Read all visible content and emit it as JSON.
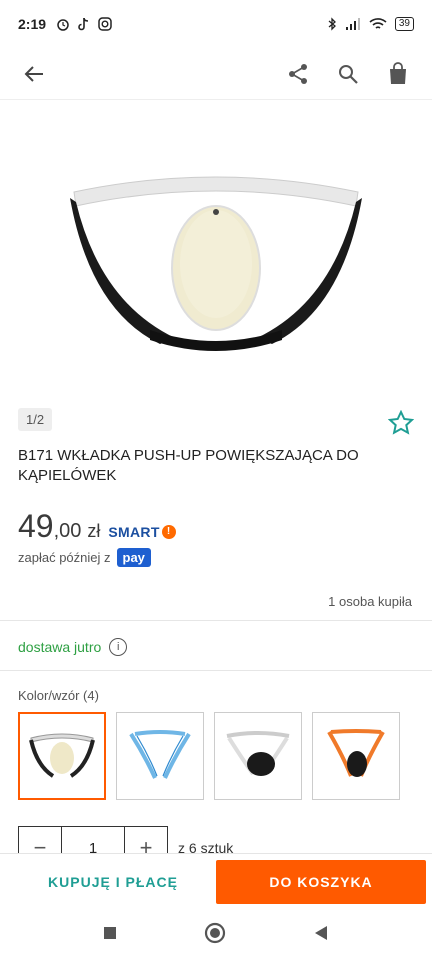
{
  "status": {
    "time": "2:19",
    "battery": "39"
  },
  "gallery": {
    "counter": "1/2"
  },
  "product": {
    "title": "B171 WKŁADKA PUSH-UP POWIĘKSZAJĄCA DO KĄPIELÓWEK",
    "price_main": "49",
    "price_decimal": ",00",
    "currency": "zł",
    "smart": "SMART",
    "pay_later": "zapłać później z",
    "pay_logo": "pay",
    "buyers": "1 osoba kupiła",
    "delivery": "dostawa jutro"
  },
  "variants": {
    "label": "Kolor/wzór (4)",
    "items": [
      {
        "name": "white-beige",
        "selected": true
      },
      {
        "name": "blue",
        "selected": false
      },
      {
        "name": "black-white",
        "selected": false
      },
      {
        "name": "orange-black",
        "selected": false
      }
    ]
  },
  "quantity": {
    "value": "1",
    "minus": "−",
    "plus": "+",
    "note": "z 6 sztuk"
  },
  "actions": {
    "buy_now": "KUPUJĘ I PŁACĘ",
    "add_to_cart": "DO KOSZYKA"
  },
  "colors": {
    "accent": "#ff5a00",
    "teal": "#1f9e94",
    "green": "#2ea043"
  },
  "icons": [
    "back-arrow-icon",
    "share-icon",
    "search-icon",
    "cart-bag-icon",
    "star-icon",
    "info-icon"
  ]
}
